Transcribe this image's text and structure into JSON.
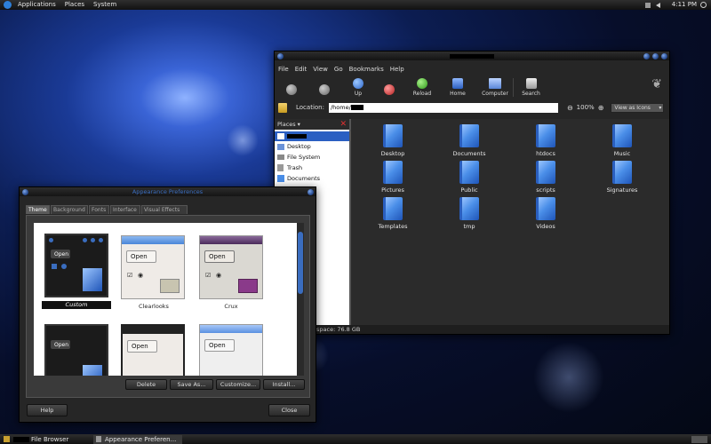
{
  "top_panel": {
    "menus": [
      "Applications",
      "Places",
      "System"
    ],
    "clock": "4:11 PM"
  },
  "file_browser": {
    "menu": [
      "File",
      "Edit",
      "View",
      "Go",
      "Bookmarks",
      "Help"
    ],
    "toolbar": [
      "Up",
      "Reload",
      "Home",
      "Computer",
      "Search"
    ],
    "location_label": "Location:",
    "location_value": "/home/",
    "zoom": "100%",
    "view_mode": "View as Icons",
    "sidebar_header": "Places",
    "places": [
      "Desktop",
      "File System",
      "Trash",
      "Documents"
    ],
    "status_text": "space: 76.8 GB",
    "files": [
      "Desktop",
      "Documents",
      "htdocs",
      "Music",
      "Pictures",
      "Public",
      "scripts",
      "Signatures",
      "Templates",
      "tmp",
      "Videos"
    ]
  },
  "appearance": {
    "title": "Appearance Preferences",
    "tabs": [
      "Theme",
      "Background",
      "Fonts",
      "Interface",
      "Visual Effects"
    ],
    "themes": [
      "Custom",
      "Clearlooks",
      "Crux"
    ],
    "sample_button": "Open",
    "actions": [
      "Delete",
      "Save As...",
      "Customize...",
      "Install..."
    ],
    "help": "Help",
    "close": "Close"
  },
  "taskbar": {
    "items": [
      "File Browser",
      "Appearance Preferen..."
    ]
  },
  "colors": {
    "accent": "#3a6dbf",
    "window_bg": "#262626",
    "selected_theme": "#111111"
  }
}
